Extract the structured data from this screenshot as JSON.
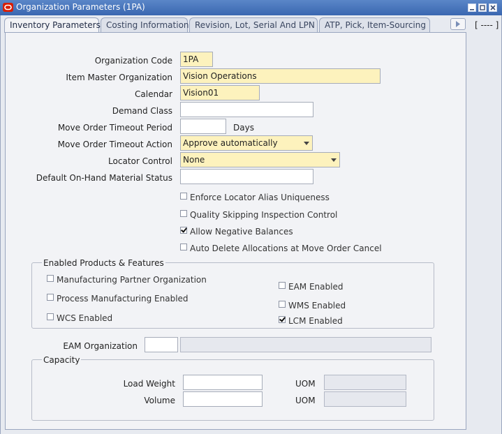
{
  "window": {
    "title": "Organization Parameters (1PA)"
  },
  "tabs": [
    "Inventory Parameters",
    "Costing Information",
    "Revision, Lot, Serial And LPN",
    "ATP, Pick, Item-Sourcing"
  ],
  "side_indicator": "[ ---- ]",
  "form": {
    "org_code_label": "Organization Code",
    "org_code_value": "1PA",
    "item_master_label": "Item Master Organization",
    "item_master_value": "Vision Operations",
    "calendar_label": "Calendar",
    "calendar_value": "Vision01",
    "demand_class_label": "Demand Class",
    "demand_class_value": "",
    "timeout_period_label": "Move Order Timeout Period",
    "timeout_period_value": "",
    "timeout_period_unit": "Days",
    "timeout_action_label": "Move Order Timeout Action",
    "timeout_action_value": "Approve automatically",
    "locator_control_label": "Locator Control",
    "locator_control_value": "None",
    "onhand_status_label": "Default On-Hand Material Status",
    "onhand_status_value": ""
  },
  "checkboxes": [
    {
      "label": "Enforce Locator Alias Uniqueness",
      "checked": false
    },
    {
      "label": "Quality Skipping Inspection Control",
      "checked": false
    },
    {
      "label": "Allow Negative Balances",
      "checked": true
    },
    {
      "label": "Auto Delete Allocations at Move Order Cancel",
      "checked": false
    }
  ],
  "products": {
    "title": "Enabled Products & Features",
    "items": [
      {
        "label": "Manufacturing Partner Organization",
        "checked": false
      },
      {
        "label": "Process Manufacturing Enabled",
        "checked": false
      },
      {
        "label": "WCS Enabled",
        "checked": false
      },
      {
        "label": "EAM Enabled",
        "checked": false
      },
      {
        "label": "WMS Enabled",
        "checked": false
      },
      {
        "label": "LCM Enabled",
        "checked": true
      }
    ]
  },
  "eam": {
    "label": "EAM Organization",
    "code": "",
    "name": ""
  },
  "capacity": {
    "title": "Capacity",
    "load_weight_label": "Load Weight",
    "load_weight_value": "",
    "volume_label": "Volume",
    "volume_value": "",
    "uom_label": "UOM",
    "weight_uom": "",
    "volume_uom": ""
  }
}
